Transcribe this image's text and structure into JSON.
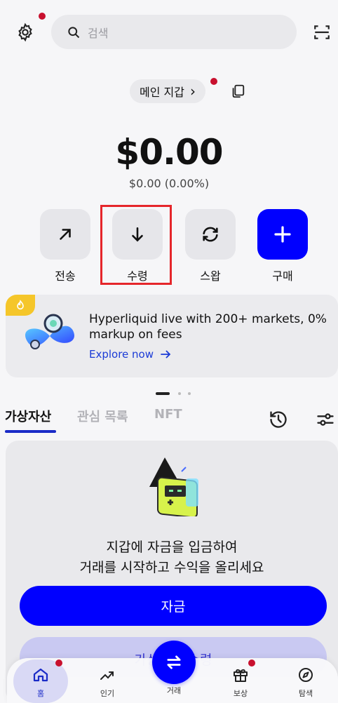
{
  "header": {
    "search_placeholder": "검색"
  },
  "wallet": {
    "name": "메인 지갑",
    "chevron": "›",
    "balance": "$0.00",
    "change": "$0.00 (0.00%)"
  },
  "actions": [
    {
      "label": "전송",
      "icon": "arrow-up-right-icon"
    },
    {
      "label": "수령",
      "icon": "arrow-down-icon"
    },
    {
      "label": "스왑",
      "icon": "swap-refresh-icon"
    },
    {
      "label": "구매",
      "icon": "plus-icon"
    }
  ],
  "promo": {
    "title": "Hyperliquid live with 200+ markets, 0% markup on fees",
    "link": "Explore now"
  },
  "tabs": [
    {
      "label": "가상자산",
      "active": true
    },
    {
      "label": "관심 목록",
      "active": false
    },
    {
      "label": "NFT",
      "active": false
    }
  ],
  "empty_state": {
    "line1": "지갑에 자금을 입금하여",
    "line2": "거래를 시작하고 수익을 올리세요",
    "primary_button": "자금",
    "secondary_button": "가상자산 수령"
  },
  "bottom_nav": [
    {
      "label": "홈",
      "icon": "home-icon"
    },
    {
      "label": "인기",
      "icon": "trending-icon"
    },
    {
      "label": "거래",
      "icon": "swap-icon"
    },
    {
      "label": "보상",
      "icon": "gift-icon"
    },
    {
      "label": "탐색",
      "icon": "compass-icon"
    }
  ],
  "colors": {
    "accent": "#0000ff",
    "notification_dot": "#c8102e",
    "highlight": "#e5262b"
  }
}
